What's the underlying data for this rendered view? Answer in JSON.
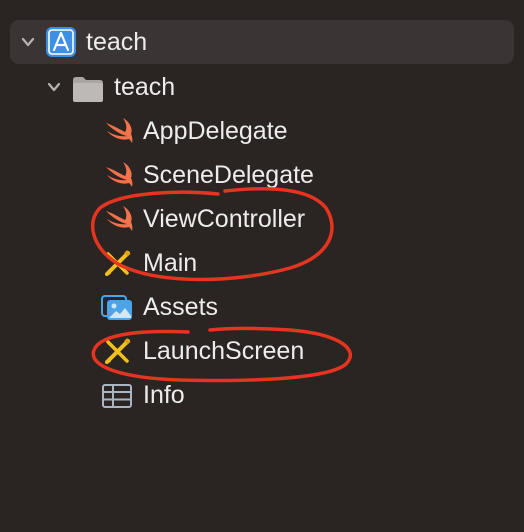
{
  "navigator": {
    "project": {
      "name": "teach",
      "icon": "xcode-project-icon",
      "expanded": true
    },
    "group": {
      "name": "teach",
      "icon": "folder-icon",
      "expanded": true
    },
    "files": [
      {
        "name": "AppDelegate",
        "icon": "swift-file-icon"
      },
      {
        "name": "SceneDelegate",
        "icon": "swift-file-icon"
      },
      {
        "name": "ViewController",
        "icon": "swift-file-icon"
      },
      {
        "name": "Main",
        "icon": "storyboard-icon"
      },
      {
        "name": "Assets",
        "icon": "asset-catalog-icon"
      },
      {
        "name": "LaunchScreen",
        "icon": "storyboard-icon"
      },
      {
        "name": "Info",
        "icon": "plist-icon"
      }
    ]
  },
  "colors": {
    "background": "#2a2523",
    "selected_row": "#3a3534",
    "text": "#ececec",
    "swift": "#f0734a",
    "storyboard": "#f2c01e",
    "asset": "#4ba3e8",
    "annotation": "#e5341f"
  }
}
